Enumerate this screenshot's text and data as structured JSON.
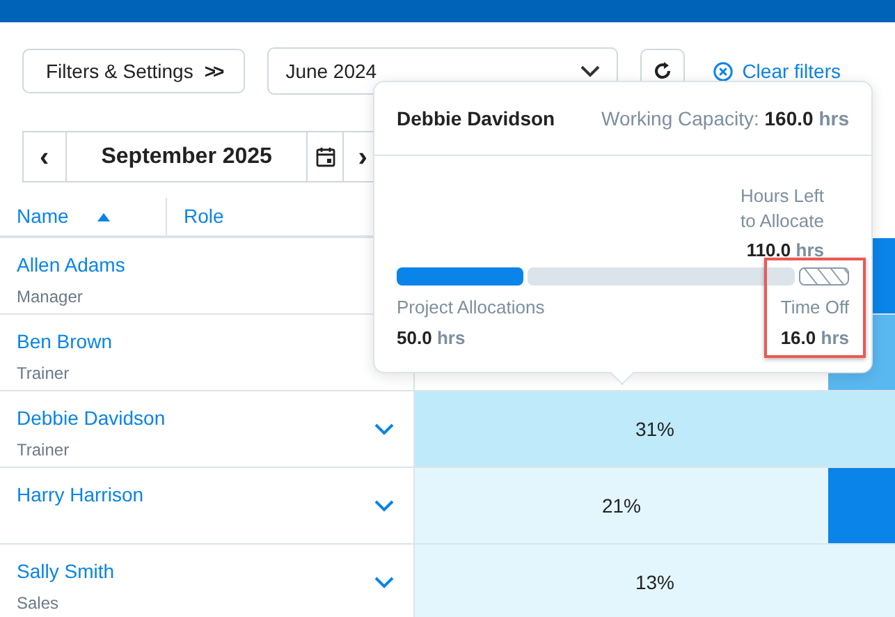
{
  "toolbar": {
    "filters_button": "Filters & Settings",
    "filters_icon": ">>",
    "period_select": {
      "value": "June 2024"
    },
    "clear_filters": "Clear filters"
  },
  "date_nav": {
    "prev": "‹",
    "month": "September 2025",
    "next": "›"
  },
  "columns": [
    {
      "label": "Name",
      "sorted": true
    },
    {
      "label": "Role",
      "sorted": false
    }
  ],
  "rows": [
    {
      "name": "Allen Adams",
      "role": "Manager",
      "side_cell": {
        "color": "#0a84e8"
      }
    },
    {
      "name": "Ben Brown",
      "role": "Trainer",
      "side_cell": {
        "color": "#5ab8f0"
      }
    },
    {
      "name": "Debbie Davidson",
      "role": "Trainer",
      "cell": {
        "text": "31%",
        "color": "#bfeafa"
      }
    },
    {
      "name": "Harry Harrison",
      "cell": {
        "text": "21%",
        "color": "#e3f6fd"
      },
      "side_cell": {
        "color": "#0a84e8"
      }
    },
    {
      "name": "Sally Smith",
      "role": "Sales",
      "cell": {
        "text": "13%",
        "color": "#e3f6fd"
      }
    }
  ],
  "popover": {
    "name": "Debbie Davidson",
    "capacity_label": "Working Capacity:",
    "capacity_value": "160.0",
    "capacity_unit": "hrs",
    "hours_left": {
      "label": "Hours Left to Allocate",
      "value": "110.0",
      "unit": "hrs"
    },
    "segments": [
      {
        "kind": "allocated"
      },
      {
        "kind": "remaining"
      },
      {
        "kind": "timeoff"
      }
    ],
    "allocations": {
      "label": "Project Allocations",
      "value": "50.0",
      "unit": "hrs"
    },
    "time_off": {
      "label": "Time Off",
      "value": "16.0",
      "unit": "hrs",
      "highlighted": true
    }
  }
}
